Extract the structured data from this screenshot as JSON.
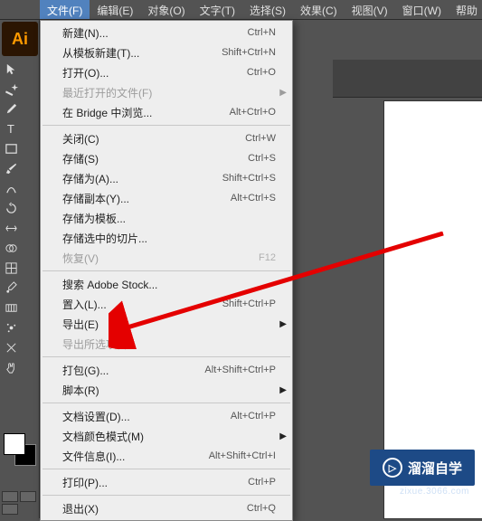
{
  "menubar": {
    "items": [
      {
        "label": "文件(F)",
        "active": true
      },
      {
        "label": "编辑(E)"
      },
      {
        "label": "对象(O)"
      },
      {
        "label": "文字(T)"
      },
      {
        "label": "选择(S)"
      },
      {
        "label": "效果(C)"
      },
      {
        "label": "视图(V)"
      },
      {
        "label": "窗口(W)"
      },
      {
        "label": "帮助"
      }
    ]
  },
  "app": {
    "logo": "Ai"
  },
  "dropdown": {
    "groups": [
      [
        {
          "label": "新建(N)...",
          "shortcut": "Ctrl+N"
        },
        {
          "label": "从模板新建(T)...",
          "shortcut": "Shift+Ctrl+N"
        },
        {
          "label": "打开(O)...",
          "shortcut": "Ctrl+O"
        },
        {
          "label": "最近打开的文件(F)",
          "submenu": true,
          "disabled": true
        },
        {
          "label": "在 Bridge 中浏览...",
          "shortcut": "Alt+Ctrl+O"
        }
      ],
      [
        {
          "label": "关闭(C)",
          "shortcut": "Ctrl+W"
        },
        {
          "label": "存储(S)",
          "shortcut": "Ctrl+S"
        },
        {
          "label": "存储为(A)...",
          "shortcut": "Shift+Ctrl+S"
        },
        {
          "label": "存储副本(Y)...",
          "shortcut": "Alt+Ctrl+S"
        },
        {
          "label": "存储为模板..."
        },
        {
          "label": "存储选中的切片..."
        },
        {
          "label": "恢复(V)",
          "shortcut": "F12",
          "disabled": true
        }
      ],
      [
        {
          "label": "搜索 Adobe Stock..."
        },
        {
          "label": "置入(L)...",
          "shortcut": "Shift+Ctrl+P"
        },
        {
          "label": "导出(E)",
          "submenu": true
        },
        {
          "label": "导出所选项目...",
          "disabled": true
        }
      ],
      [
        {
          "label": "打包(G)...",
          "shortcut": "Alt+Shift+Ctrl+P"
        },
        {
          "label": "脚本(R)",
          "submenu": true
        }
      ],
      [
        {
          "label": "文档设置(D)...",
          "shortcut": "Alt+Ctrl+P"
        },
        {
          "label": "文档颜色模式(M)",
          "submenu": true
        },
        {
          "label": "文件信息(I)...",
          "shortcut": "Alt+Shift+Ctrl+I"
        }
      ],
      [
        {
          "label": "打印(P)...",
          "shortcut": "Ctrl+P"
        }
      ],
      [
        {
          "label": "退出(X)",
          "shortcut": "Ctrl+Q"
        }
      ]
    ]
  },
  "watermark": {
    "text": "溜溜自学",
    "sub": "zixue.3066.com"
  }
}
